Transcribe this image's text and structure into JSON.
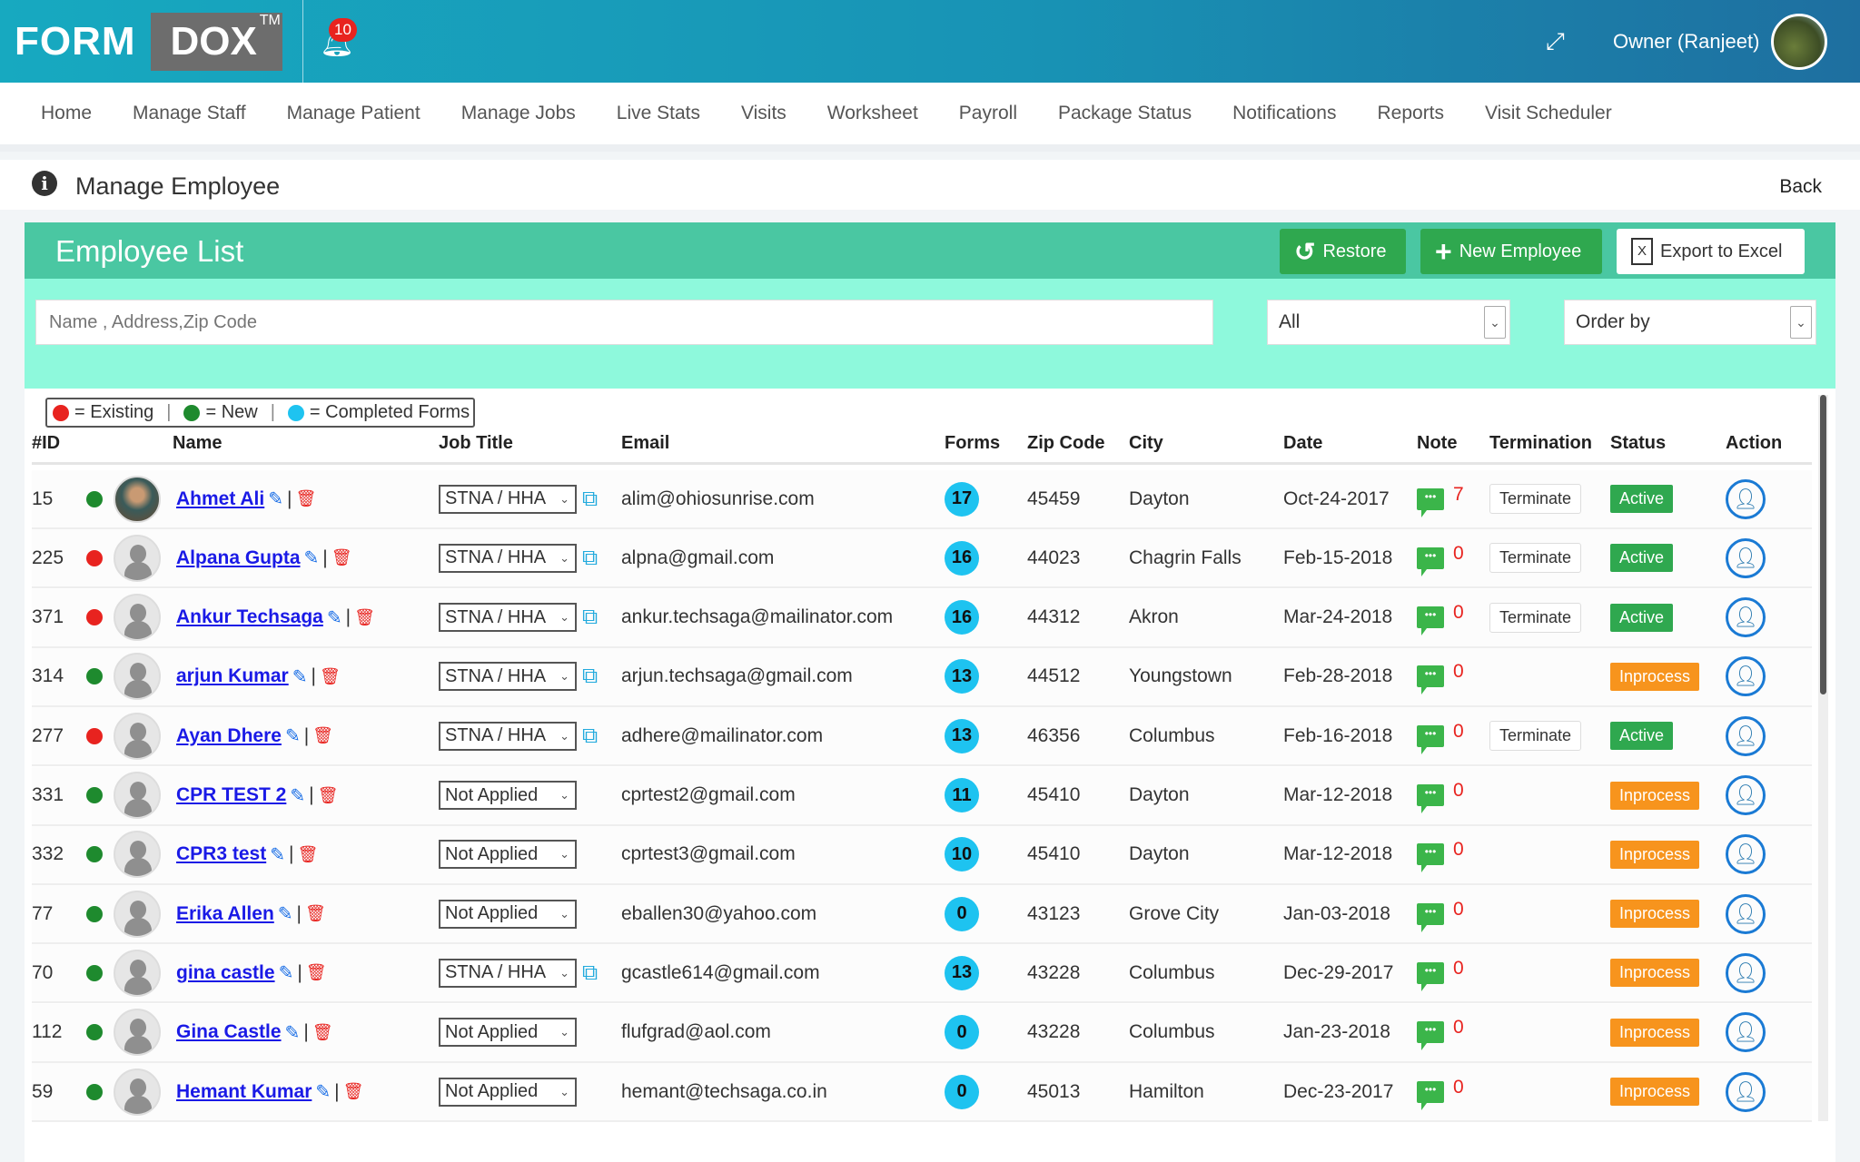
{
  "header": {
    "logo_left": "FORM",
    "logo_right": "DOX",
    "logo_tm": "TM",
    "notification_count": "10",
    "user": "Owner (Ranjeet)"
  },
  "nav": [
    "Home",
    "Manage Staff",
    "Manage Patient",
    "Manage Jobs",
    "Live Stats",
    "Visits",
    "Worksheet",
    "Payroll",
    "Package Status",
    "Notifications",
    "Reports",
    "Visit Scheduler"
  ],
  "page": {
    "title": "Manage Employee",
    "back": "Back"
  },
  "panel": {
    "title": "Employee List",
    "restore": "Restore",
    "new_employee": "New Employee",
    "export": "Export to Excel"
  },
  "filters": {
    "search_placeholder": "Name , Address,Zip Code",
    "type_value": "All",
    "order_value": "Order by"
  },
  "legend": {
    "existing": "= Existing",
    "new": "= New",
    "completed": "= Completed Forms"
  },
  "colors": {
    "existing": "#e8231f",
    "new": "#1e8a2e",
    "completed": "#1ec3f0",
    "active": "#2fa84f",
    "inprocess": "#f7941d"
  },
  "columns": [
    "#ID",
    "Name",
    "Job Title",
    "Email",
    "Forms",
    "Zip Code",
    "City",
    "Date",
    "Note",
    "Termination",
    "Status",
    "Action"
  ],
  "rows": [
    {
      "id": "15",
      "type": "new",
      "name": "Ahmet Ali",
      "job": "STNA / HHA",
      "email": "alim@ohiosunrise.com",
      "forms": "17",
      "zip": "45459",
      "city": "Dayton",
      "date": "Oct-24-2017",
      "notes": "7",
      "termination": "Terminate",
      "status": "Active",
      "photo": true
    },
    {
      "id": "225",
      "type": "existing",
      "name": "Alpana Gupta",
      "job": "STNA / HHA",
      "email": "alpna@gmail.com",
      "forms": "16",
      "zip": "44023",
      "city": "Chagrin Falls",
      "date": "Feb-15-2018",
      "notes": "0",
      "termination": "Terminate",
      "status": "Active"
    },
    {
      "id": "371",
      "type": "existing",
      "name": "Ankur Techsaga",
      "job": "STNA / HHA",
      "email": "ankur.techsaga@mailinator.com",
      "forms": "16",
      "zip": "44312",
      "city": "Akron",
      "date": "Mar-24-2018",
      "notes": "0",
      "termination": "Terminate",
      "status": "Active"
    },
    {
      "id": "314",
      "type": "new",
      "name": "arjun Kumar",
      "job": "STNA / HHA",
      "email": "arjun.techsaga@gmail.com",
      "forms": "13",
      "zip": "44512",
      "city": "Youngstown",
      "date": "Feb-28-2018",
      "notes": "0",
      "termination": "",
      "status": "Inprocess"
    },
    {
      "id": "277",
      "type": "existing",
      "name": "Ayan Dhere",
      "job": "STNA / HHA",
      "email": "adhere@mailinator.com",
      "forms": "13",
      "zip": "46356",
      "city": "Columbus",
      "date": "Feb-16-2018",
      "notes": "0",
      "termination": "Terminate",
      "status": "Active"
    },
    {
      "id": "331",
      "type": "new",
      "name": "CPR TEST 2",
      "job": "Not Applied",
      "email": "cprtest2@gmail.com",
      "forms": "11",
      "zip": "45410",
      "city": "Dayton",
      "date": "Mar-12-2018",
      "notes": "0",
      "termination": "",
      "status": "Inprocess"
    },
    {
      "id": "332",
      "type": "new",
      "name": "CPR3 test",
      "job": "Not Applied",
      "email": "cprtest3@gmail.com",
      "forms": "10",
      "zip": "45410",
      "city": "Dayton",
      "date": "Mar-12-2018",
      "notes": "0",
      "termination": "",
      "status": "Inprocess"
    },
    {
      "id": "77",
      "type": "new",
      "name": "Erika Allen",
      "job": "Not Applied",
      "email": "eballen30@yahoo.com",
      "forms": "0",
      "zip": "43123",
      "city": "Grove City",
      "date": "Jan-03-2018",
      "notes": "0",
      "termination": "",
      "status": "Inprocess"
    },
    {
      "id": "70",
      "type": "new",
      "name": "gina castle",
      "job": "STNA / HHA",
      "email": "gcastle614@gmail.com",
      "forms": "13",
      "zip": "43228",
      "city": "Columbus",
      "date": "Dec-29-2017",
      "notes": "0",
      "termination": "",
      "status": "Inprocess"
    },
    {
      "id": "112",
      "type": "new",
      "name": "Gina Castle",
      "job": "Not Applied",
      "email": "flufgrad@aol.com",
      "forms": "0",
      "zip": "43228",
      "city": "Columbus",
      "date": "Jan-23-2018",
      "notes": "0",
      "termination": "",
      "status": "Inprocess"
    },
    {
      "id": "59",
      "type": "new",
      "name": "Hemant Kumar",
      "job": "Not Applied",
      "email": "hemant@techsaga.co.in",
      "forms": "0",
      "zip": "45013",
      "city": "Hamilton",
      "date": "Dec-23-2017",
      "notes": "0",
      "termination": "",
      "status": "Inprocess"
    }
  ]
}
